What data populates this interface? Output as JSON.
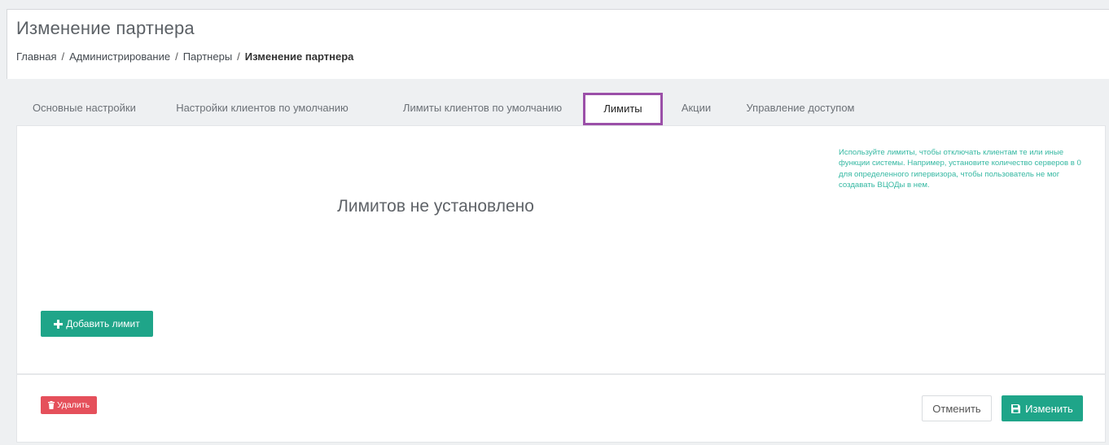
{
  "header": {
    "title": "Изменение партнера",
    "breadcrumb": [
      "Главная",
      "Администрирование",
      "Партнеры",
      "Изменение партнера"
    ],
    "breadcrumb_separator": "/"
  },
  "tabs": [
    {
      "label": "Основные настройки",
      "active": false
    },
    {
      "label": "Настройки клиентов по умолчанию",
      "active": false
    },
    {
      "label": "Лимиты клиентов по умолчанию",
      "active": false
    },
    {
      "label": "Лимиты",
      "active": true
    },
    {
      "label": "Акции",
      "active": false
    },
    {
      "label": "Управление доступом",
      "active": false
    }
  ],
  "limits": {
    "empty_message": "Лимитов не установлено",
    "hint": "Используйте лимиты, чтобы отключать клиентам те или иные функции системы. Например, установите количество серверов в 0 для определенного гипервизора, чтобы пользователь не мог создавать ВЦОДы в нем.",
    "add_button": "Добавить лимит"
  },
  "footer": {
    "delete_button": "Удалить",
    "cancel_button": "Отменить",
    "save_button": "Изменить"
  },
  "colors": {
    "accent_green": "#1fa589",
    "hint_teal": "#35b8a2",
    "delete_red": "#e5505b",
    "active_tab_border": "#9b4fa8"
  },
  "icons": {
    "add": "plus-icon",
    "delete": "trash-icon",
    "save": "floppy-disk-icon"
  }
}
